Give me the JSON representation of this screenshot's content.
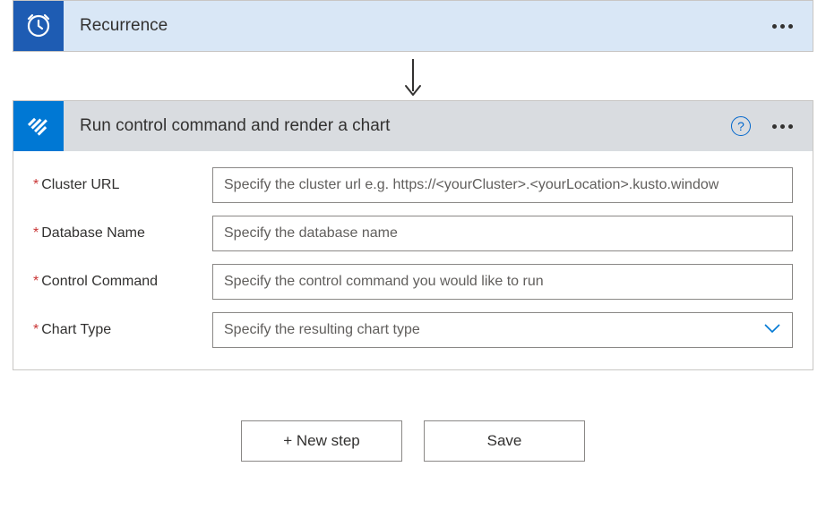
{
  "steps": {
    "recurrence": {
      "title": "Recurrence"
    },
    "control_cmd": {
      "title": "Run control command and render a chart"
    }
  },
  "form": {
    "cluster_url": {
      "label": "Cluster URL",
      "placeholder": "Specify the cluster url e.g. https://<yourCluster>.<yourLocation>.kusto.window"
    },
    "database_name": {
      "label": "Database Name",
      "placeholder": "Specify the database name"
    },
    "control_command": {
      "label": "Control Command",
      "placeholder": "Specify the control command you would like to run"
    },
    "chart_type": {
      "label": "Chart Type",
      "placeholder": "Specify the resulting chart type"
    }
  },
  "buttons": {
    "new_step": "+ New step",
    "save": "Save"
  },
  "help": "?"
}
